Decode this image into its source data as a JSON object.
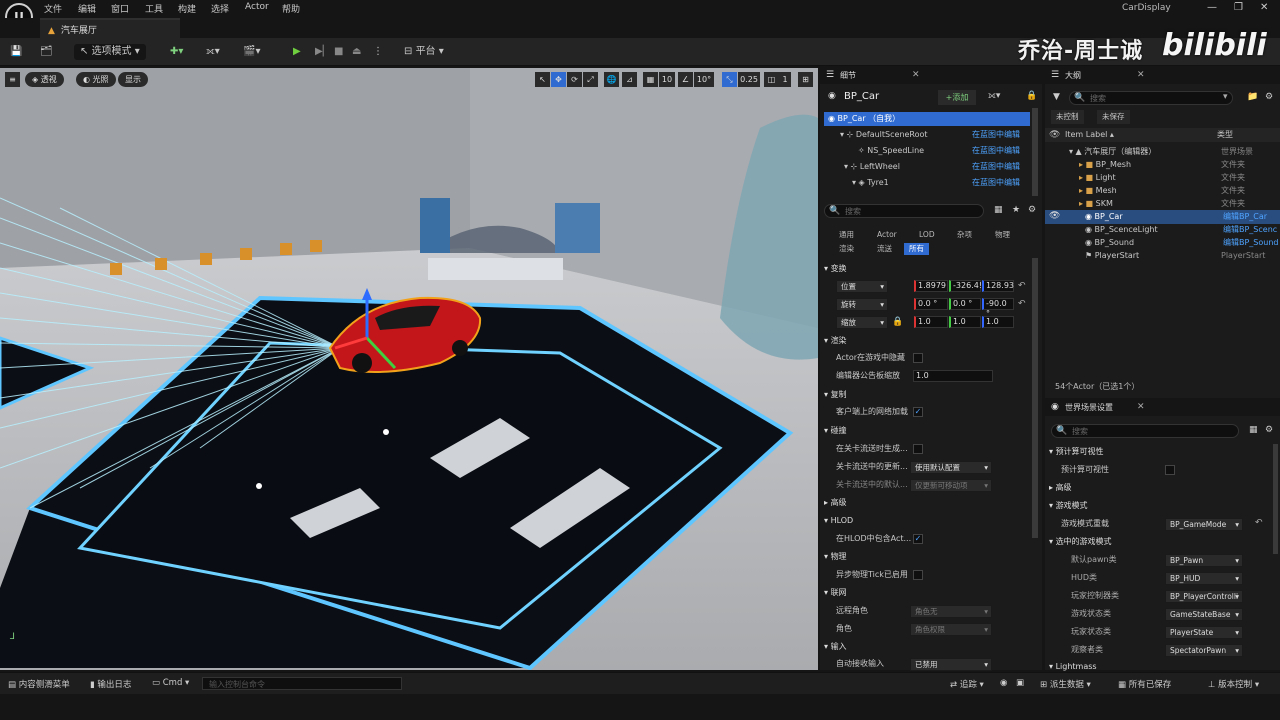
{
  "menubar": {
    "logo": "U",
    "items": [
      "文件",
      "编辑",
      "窗口",
      "工具",
      "构建",
      "选择",
      "Actor",
      "帮助"
    ],
    "project": "CarDisplay"
  },
  "tab": {
    "title": "汽车展厅"
  },
  "toolbar": {
    "mode_label": "选项模式",
    "platform_label": "平台"
  },
  "watermark": {
    "author": "乔治-周士诚",
    "site": "bilibili"
  },
  "viewport": {
    "perspective": "透视",
    "lighting": "光照",
    "show": "显示",
    "grid_snap": "10",
    "rot_snap": "10°",
    "scale_snap": "0.25",
    "camera_speed": "1"
  },
  "details": {
    "tab": "细节",
    "actor": "BP_Car",
    "add": "+添加",
    "components": [
      {
        "name": "BP_Car （自我）",
        "link": ""
      },
      {
        "name": "DefaultSceneRoot",
        "link": "在蓝图中编辑"
      },
      {
        "name": "NS_SpeedLine",
        "link": "在蓝图中编辑"
      },
      {
        "name": "LeftWheel",
        "link": "在蓝图中编辑"
      },
      {
        "name": "Tyre1",
        "link": "在蓝图中编辑"
      }
    ],
    "search_placeholder": "搜索",
    "filters": [
      "通用",
      "Actor",
      "LOD",
      "杂项",
      "物理",
      "渲染",
      "流送",
      "所有"
    ],
    "transform_cat": "变换",
    "location": {
      "label": "位置",
      "x": "1.8979",
      "y": "-326.4!",
      "z": "128.93"
    },
    "rotation": {
      "label": "旋转",
      "x": "0.0 °",
      "y": "0.0 °",
      "z": "-90.0 °"
    },
    "scale": {
      "label": "缩放",
      "x": "1.0",
      "y": "1.0",
      "z": "1.0"
    },
    "render_cat": "渲染",
    "hidden_in_game": "Actor在游戏中隐藏",
    "billboard_scale": "编辑器公告板缩放",
    "billboard_value": "1.0",
    "replication_cat": "复制",
    "net_load": "客户端上的网络加载",
    "collision_cat": "碰撞",
    "gen_overlap_stream": "在关卡流送时生成...",
    "update_overlap": "关卡流送中的更新...",
    "update_overlap_value": "使用默认配置",
    "default_update": "关卡流送中的默认...",
    "default_update_value": "仅更新可移动项",
    "advanced_cat": "高级",
    "hlod_cat": "HLOD",
    "include_hlod": "在HLOD中包含Act...",
    "physics_cat": "物理",
    "async_tick": "异步物理Tick已启用",
    "network_cat": "联网",
    "remote_role": "远程角色",
    "remote_role_value": "角色无",
    "role": "角色",
    "role_value": "角色权限",
    "input_cat": "输入",
    "auto_input": "自动接收输入",
    "auto_input_value": "已禁用"
  },
  "outliner": {
    "tab": "大纲",
    "search_placeholder": "搜索",
    "unsaved1": "未控制",
    "unsaved2": "未保存",
    "col_label": "Item Label ▴",
    "col_type": "类型",
    "items": [
      {
        "name": "汽车展厅（编辑器）",
        "type": "世界场景"
      },
      {
        "name": "BP_Mesh",
        "type": "文件夹"
      },
      {
        "name": "Light",
        "type": "文件夹"
      },
      {
        "name": "Mesh",
        "type": "文件夹"
      },
      {
        "name": "SKM",
        "type": "文件夹"
      },
      {
        "name": "BP_Car",
        "type": "编辑BP_Car"
      },
      {
        "name": "BP_ScenceLight",
        "type": "编辑BP_Scenc"
      },
      {
        "name": "BP_Sound",
        "type": "编辑BP_Sound"
      },
      {
        "name": "PlayerStart",
        "type": "PlayerStart"
      }
    ],
    "count": "54个Actor（已选1个）"
  },
  "world": {
    "tab": "世界场景设置",
    "search_placeholder": "搜索",
    "precomp_cat": "预计算可视性",
    "precomp": "预计算可视性",
    "advanced": "高级",
    "gamemode_cat": "游戏模式",
    "gamemode_override": "游戏模式重载",
    "gamemode_value": "BP_GameMode",
    "selected_gm": "选中的游戏模式",
    "rows": [
      {
        "label": "默认pawn类",
        "value": "BP_Pawn"
      },
      {
        "label": "HUD类",
        "value": "BP_HUD"
      },
      {
        "label": "玩家控制器类",
        "value": "BP_PlayerControlli"
      },
      {
        "label": "游戏状态类",
        "value": "GameStateBase"
      },
      {
        "label": "玩家状态类",
        "value": "PlayerState"
      },
      {
        "label": "观察者类",
        "value": "SpectatorPawn"
      }
    ],
    "lightmass": "Lightmass"
  },
  "statusbar": {
    "content_drawer": "内容侧滑菜单",
    "output_log": "输出日志",
    "cmd": "Cmd",
    "console_placeholder": "输入控制台命令",
    "trace": "追踪",
    "derived": "派生数据",
    "saved": "所有已保存",
    "source": "版本控制"
  }
}
